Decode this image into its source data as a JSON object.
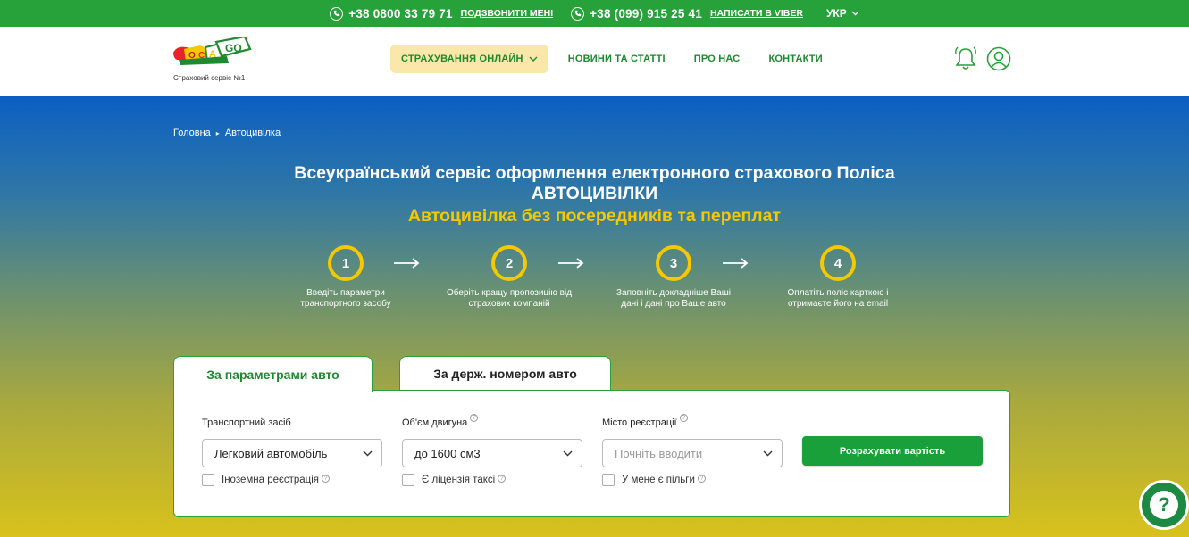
{
  "topbar": {
    "phone1": "+38 0800 33 79 71",
    "call_link": "ПОДЗВОНИТИ МЕНІ",
    "phone2": "+38 (099) 915 25 41",
    "viber_link": "НАПИСАТИ В VIBER",
    "lang": "УКР"
  },
  "logo": {
    "tagline": "Страховий сервіс №1"
  },
  "nav": {
    "items": [
      "СТРАХУВАННЯ ОНЛАЙН",
      "НОВИНИ ТА СТАТТІ",
      "ПРО НАС",
      "КОНТАКТИ"
    ]
  },
  "breadcrumb": {
    "home": "Головна",
    "current": "Автоцивілка"
  },
  "hero": {
    "title_line1": "Всеукраїнський сервіс оформлення електронного страхового Поліса",
    "title_line2": "АВТОЦИВІЛКИ",
    "subtitle": "Автоцивілка без посередників та переплат"
  },
  "steps": [
    {
      "num": "1",
      "line1": "Введіть параметри",
      "line2": "транспортного засобу"
    },
    {
      "num": "2",
      "line1": "Оберіть кращу пропозицію від",
      "line2": "страхових компаній"
    },
    {
      "num": "3",
      "line1": "Заповніть докладніше Ваші",
      "line2": "дані і дані про Ваше авто"
    },
    {
      "num": "4",
      "line1": "Оплатіть поліс карткою і",
      "line2": "отримаєте його на email"
    }
  ],
  "tabs": {
    "by_params": "За параметрами авто",
    "by_plate": "За держ. номером авто"
  },
  "form": {
    "vehicle_label": "Транспортний засіб",
    "vehicle_value": "Легковий автомобіль",
    "engine_label": "Об'єм двигуна",
    "engine_value": "до 1600 см3",
    "city_label": "Місто реєстрації",
    "city_placeholder": "Почніть вводити",
    "foreign_reg": "Іноземна реєстрація",
    "taxi": "Є ліцензія таксі",
    "benefits": "У мене є пільги",
    "submit": "Розрахувати вартість",
    "help_mark": "?"
  },
  "colors": {
    "green": "#27a23b",
    "yellow": "#f5c800",
    "blue": "#0b5fc3"
  }
}
